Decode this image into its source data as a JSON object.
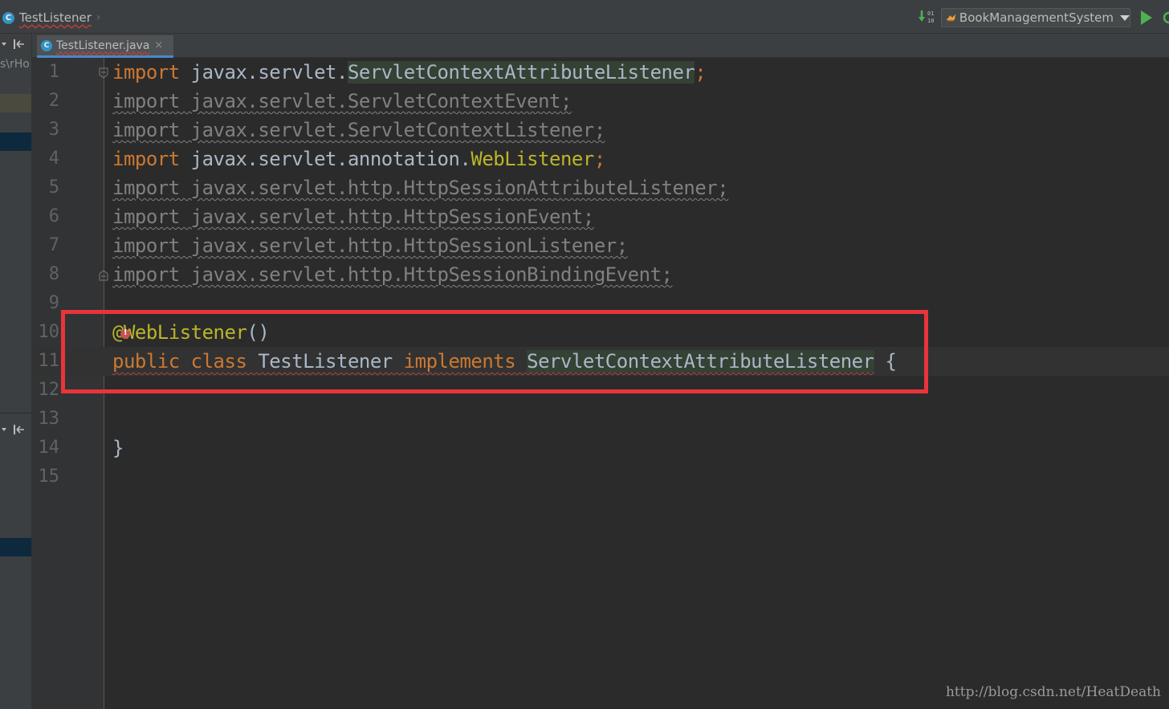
{
  "navbar": {
    "breadcrumb": "TestListener",
    "class_icon_letter": "C",
    "run_config": "BookManagementSystem"
  },
  "left_panel": {
    "path_fragment": "s\\rHo"
  },
  "tabs": [
    {
      "label": "TestListener.java",
      "icon_letter": "C",
      "close": "×",
      "active": true
    }
  ],
  "editor": {
    "line_numbers": [
      "1",
      "2",
      "3",
      "4",
      "5",
      "6",
      "7",
      "8",
      "9",
      "10",
      "11",
      "12",
      "13",
      "14",
      "15"
    ],
    "lines": [
      {
        "kw": "import",
        "pkg": "javax.servlet.",
        "name": "ServletContextAttributeListener",
        "semi": ";"
      },
      {
        "text": "import javax.servlet.ServletContextEvent;"
      },
      {
        "text": "import javax.servlet.ServletContextListener;"
      },
      {
        "kw": "import",
        "pkg": "javax.servlet.annotation.",
        "name": "WebListener",
        "semi": ";"
      },
      {
        "text": "import javax.servlet.http.HttpSessionAttributeListener;"
      },
      {
        "text": "import javax.servlet.http.HttpSessionEvent;"
      },
      {
        "text": "import javax.servlet.http.HttpSessionListener;"
      },
      {
        "text": "import javax.servlet.http.HttpSessionBindingEvent;"
      }
    ],
    "line10": {
      "at": "@",
      "name": "WebListener",
      "parens": "()"
    },
    "line11": {
      "public": "public",
      "class": "class",
      "classname": "TestListener",
      "implements": "implements",
      "iface": "ServletContextAttributeListener",
      "brace": "{"
    },
    "line14": "}"
  },
  "watermark": "http://blog.csdn.net/HeatDeath",
  "colors": {
    "keyword": "#cc7832",
    "annotation": "#bbb529",
    "highlight_box": "#e8343a",
    "error_underline": "#bc3f3c"
  }
}
